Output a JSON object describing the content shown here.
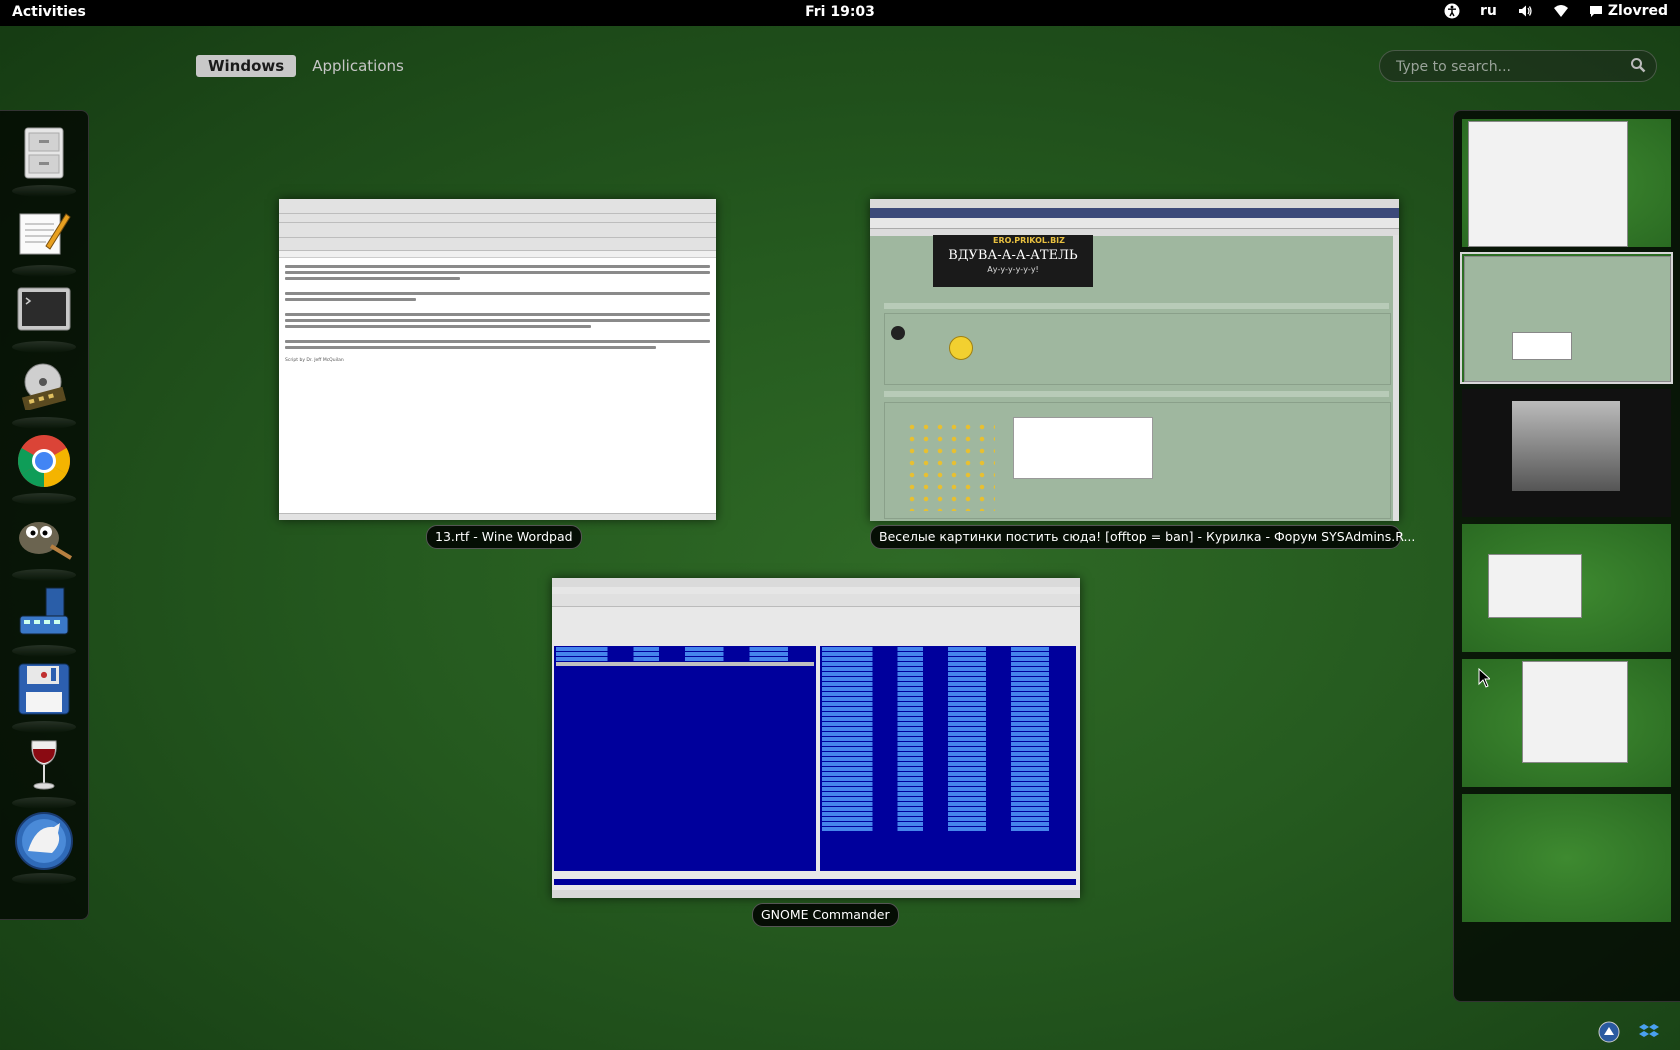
{
  "topbar": {
    "activities": "Activities",
    "clock": "Fri 19:03",
    "language": "ru",
    "user": "Zlovred"
  },
  "overview": {
    "tabs": [
      {
        "label": "Windows",
        "active": true
      },
      {
        "label": "Applications",
        "active": false
      }
    ],
    "search_placeholder": "Type to search..."
  },
  "dash": {
    "items": [
      {
        "icon": "file-cabinet-icon"
      },
      {
        "icon": "text-editor-icon"
      },
      {
        "icon": "terminal-icon"
      },
      {
        "icon": "media-player-icon"
      },
      {
        "icon": "chrome-icon"
      },
      {
        "icon": "gimp-icon"
      },
      {
        "icon": "video-editor-icon"
      },
      {
        "icon": "floppy-save-icon"
      },
      {
        "icon": "wine-icon"
      },
      {
        "icon": "wolf-app-icon"
      }
    ]
  },
  "windows": {
    "wordpad": {
      "caption": "13.rtf - Wine Wordpad",
      "footer": "Script by Dr. Jeff McQuilan"
    },
    "chrome": {
      "caption": "Веселые картинки постить сюда! [offtop = ban] - Курилка - Форум SYSAdmins.R...",
      "banner_site": "ERO.PRIKOL.BIZ",
      "banner_title": "ВДУВА-А-А-АТЕЛЬ",
      "banner_sub": "Ау-у-у-у-у-у!"
    },
    "commander": {
      "caption": "GNOME Commander"
    }
  },
  "colors": {
    "desktop": "#255a1f",
    "panel": "#000000",
    "commander_blue": "#00009c"
  }
}
